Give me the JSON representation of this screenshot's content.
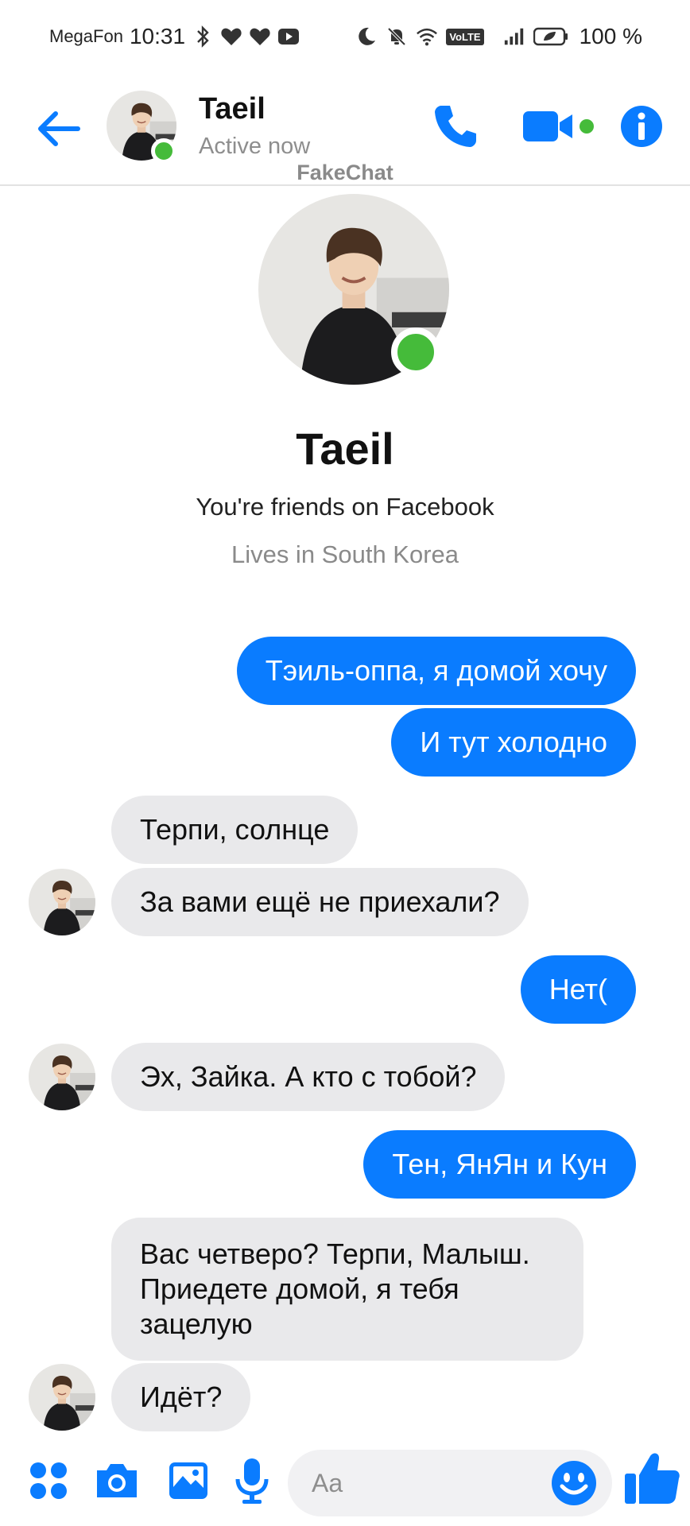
{
  "status_bar": {
    "carrier": "MegaFon",
    "time": "10:31",
    "volte": "VoLTE",
    "battery": "100 %"
  },
  "header": {
    "name": "Taeil",
    "status": "Active now",
    "watermark": "FakeChat"
  },
  "profile": {
    "name": "Taeil",
    "friends_text": "You're friends on Facebook",
    "lives_text": "Lives in South Korea"
  },
  "messages": [
    {
      "from": "me",
      "text": "Тэиль-оппа, я домой хочу"
    },
    {
      "from": "me",
      "text": "И тут холодно"
    },
    {
      "from": "them",
      "text": "Терпи, солнце"
    },
    {
      "from": "them",
      "text": "За вами ещё не приехали?"
    },
    {
      "from": "me",
      "text": "Нет("
    },
    {
      "from": "them",
      "text": "Эх, Зайка. А кто с тобой?"
    },
    {
      "from": "me",
      "text": "Тен, ЯнЯн и Кун"
    },
    {
      "from": "them",
      "text": "Вас четверо? Терпи, Малыш. Приедете домой, я тебя зацелую"
    },
    {
      "from": "them",
      "text": "Идёт?"
    }
  ],
  "composer": {
    "placeholder": "Aa"
  },
  "colors": {
    "accent": "#0a7cff",
    "online": "#45bb3a",
    "incoming_bubble": "#e9e9eb"
  }
}
